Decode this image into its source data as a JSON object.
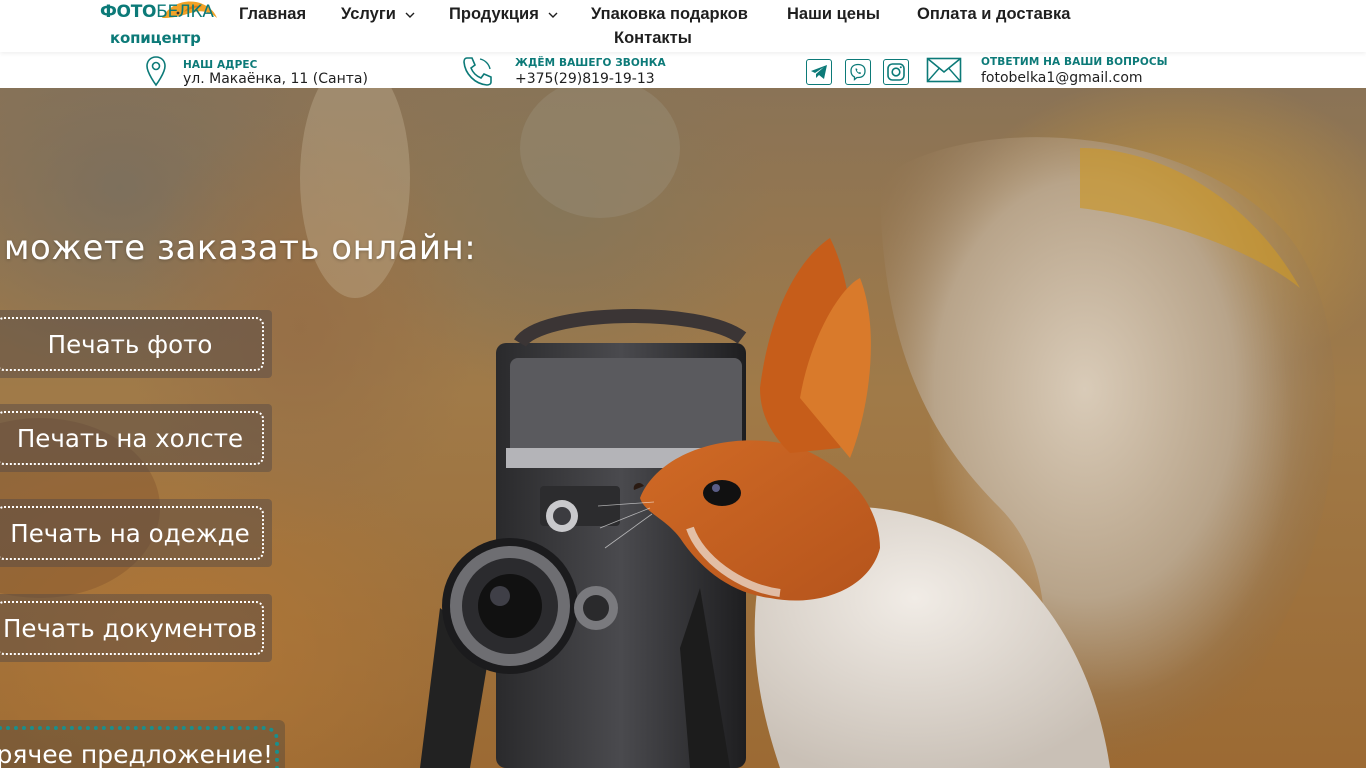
{
  "brand": {
    "logo_line1_a": "ФОТО",
    "logo_line1_b": "БЕЛКА",
    "logo_line2": "копицентр",
    "accent_color": "#0c7a78"
  },
  "nav": {
    "items": [
      {
        "label": "Главная",
        "has_dropdown": false
      },
      {
        "label": "Услуги",
        "has_dropdown": true
      },
      {
        "label": "Продукция",
        "has_dropdown": true
      },
      {
        "label": "Упаковка подарков",
        "has_dropdown": false
      },
      {
        "label": "Наши цены",
        "has_dropdown": false
      },
      {
        "label": "Оплата и доставка",
        "has_dropdown": false
      },
      {
        "label": "Контакты",
        "has_dropdown": false
      }
    ]
  },
  "contacts": {
    "address_label": "НАШ АДРЕС",
    "address_value": "ул. Макаёнка, 11 (Санта)",
    "phone_label": "ЖДЁМ ВАШЕГО ЗВОНКА",
    "phone_value": "+375(29)819-19-13",
    "email_label": "ОТВЕТИМ НА ВАШИ ВОПРОСЫ",
    "email_value": "fotobelka1@gmail.com",
    "social_icons": [
      "telegram-icon",
      "viber-icon",
      "instagram-icon",
      "mail-icon"
    ]
  },
  "hero": {
    "title": "и можете заказать онлайн:",
    "buttons": [
      "Печать фото",
      "Печать на холсте",
      "Печать на одежде",
      "Печать документов"
    ],
    "hot_offer": "Горячее предложение!"
  }
}
